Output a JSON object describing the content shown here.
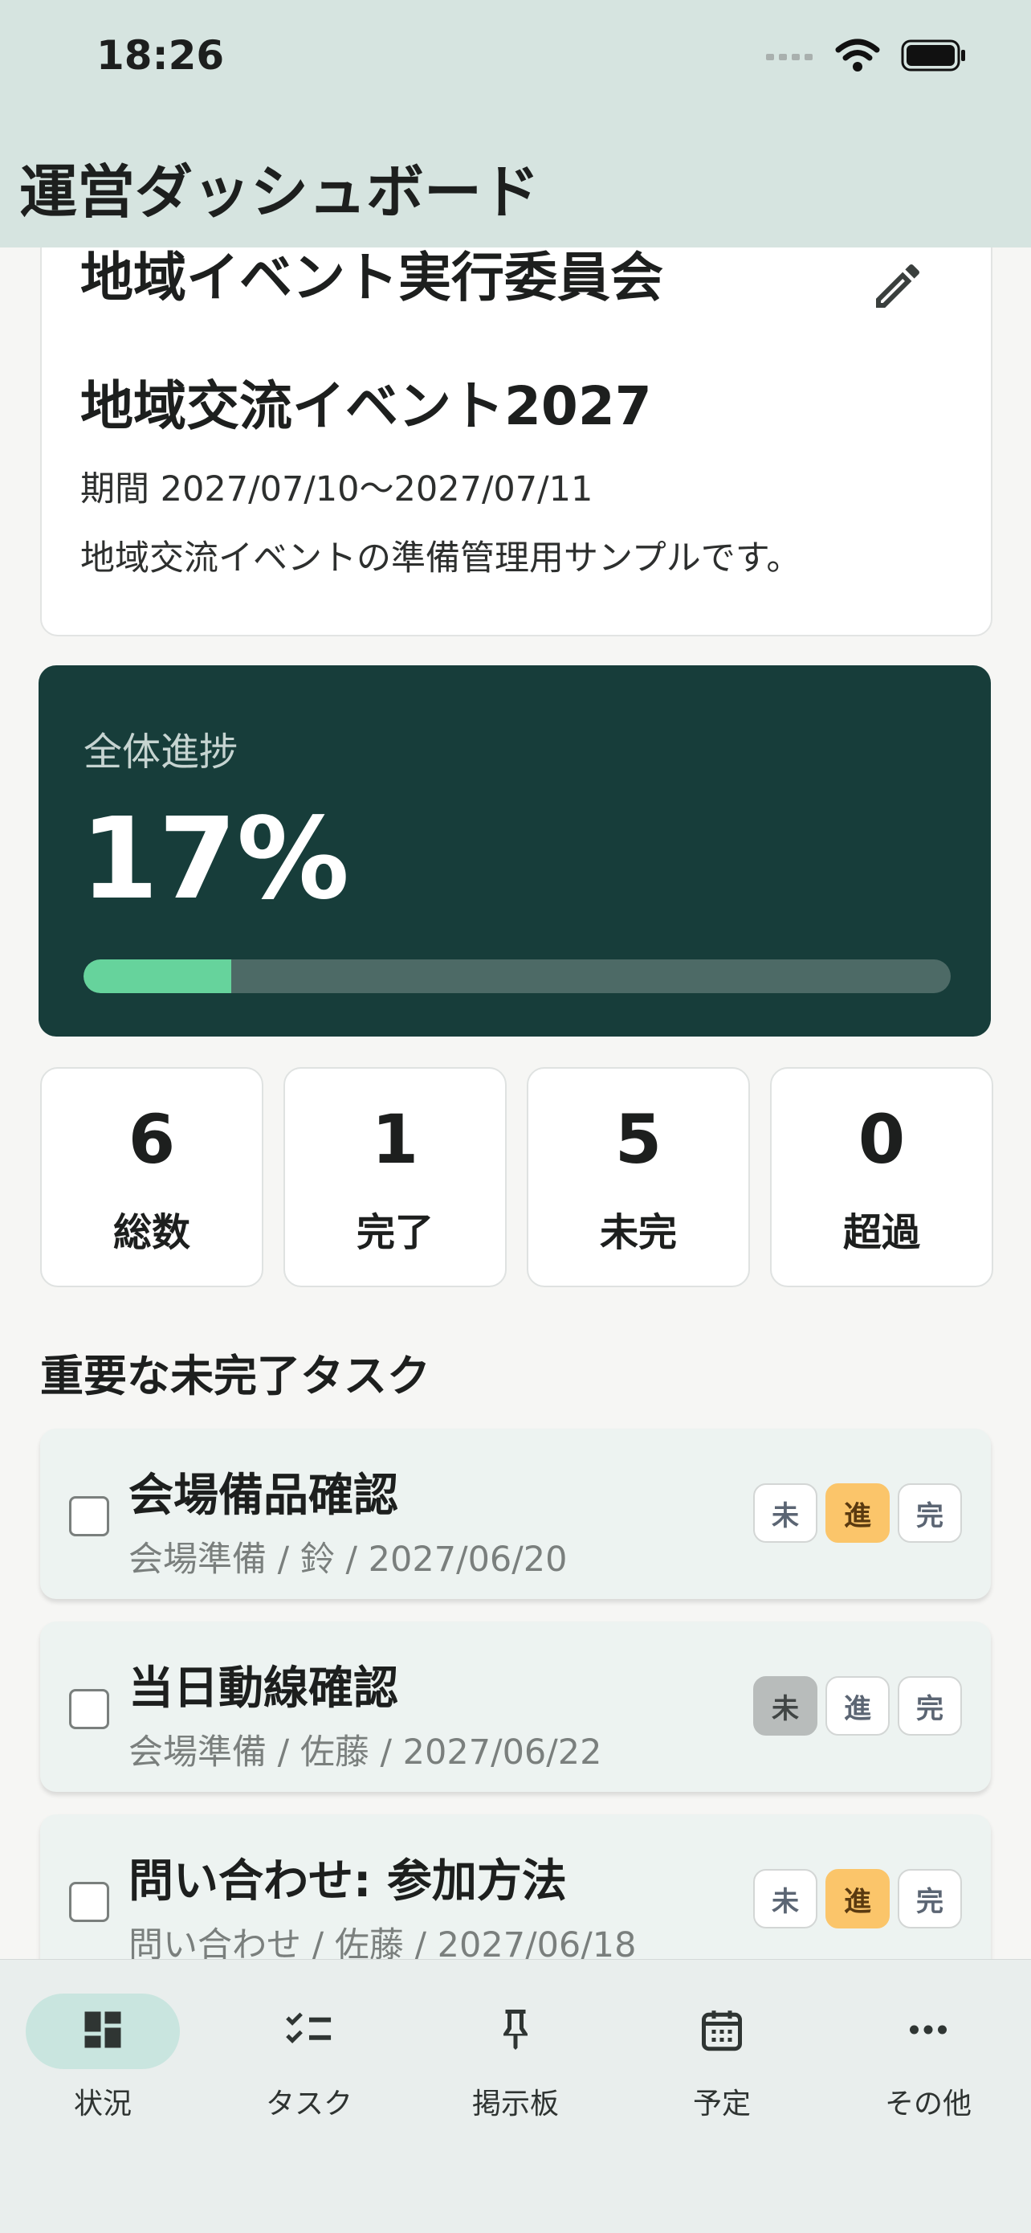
{
  "status_bar": {
    "time": "18:26"
  },
  "header": {
    "title": "運営ダッシュボード"
  },
  "project": {
    "organization": "地域イベント実行委員会",
    "event_name": "地域交流イベント2027",
    "period": "期間 2027/07/10〜2027/07/11",
    "description": "地域交流イベントの準備管理用サンプルです。"
  },
  "progress": {
    "label": "全体進捗",
    "value_text": "17%",
    "fraction": 0.17
  },
  "stats": [
    {
      "value": "6",
      "label": "総数"
    },
    {
      "value": "1",
      "label": "完了"
    },
    {
      "value": "5",
      "label": "未完"
    },
    {
      "value": "0",
      "label": "超過"
    }
  ],
  "tasks_section": {
    "title": "重要な未完了タスク",
    "status_labels": {
      "todo": "未",
      "in_progress": "進",
      "done": "完"
    },
    "tasks": [
      {
        "title": "会場備品確認",
        "meta": "会場準備 / 鈴 / 2027/06/20",
        "status": "in_progress"
      },
      {
        "title": "当日動線確認",
        "meta": "会場準備 / 佐藤 / 2027/06/22",
        "status": "todo"
      },
      {
        "title": "問い合わせ: 参加方法",
        "meta": "問い合わせ / 佐藤 / 2027/06/18",
        "status": "in_progress"
      }
    ]
  },
  "bottom_nav": [
    {
      "label": "状況",
      "icon": "dashboard-icon",
      "active": true
    },
    {
      "label": "タスク",
      "icon": "checklist-icon",
      "active": false
    },
    {
      "label": "掲示板",
      "icon": "pin-icon",
      "active": false
    },
    {
      "label": "予定",
      "icon": "calendar-icon",
      "active": false
    },
    {
      "label": "その他",
      "icon": "more-icon",
      "active": false
    }
  ],
  "colors": {
    "header_bg": "#d6e4e0",
    "progress_card_bg": "#173d3a",
    "progress_fill": "#66d39c",
    "in_progress_badge": "#fbc56a",
    "todo_badge": "#b8bcbb"
  }
}
